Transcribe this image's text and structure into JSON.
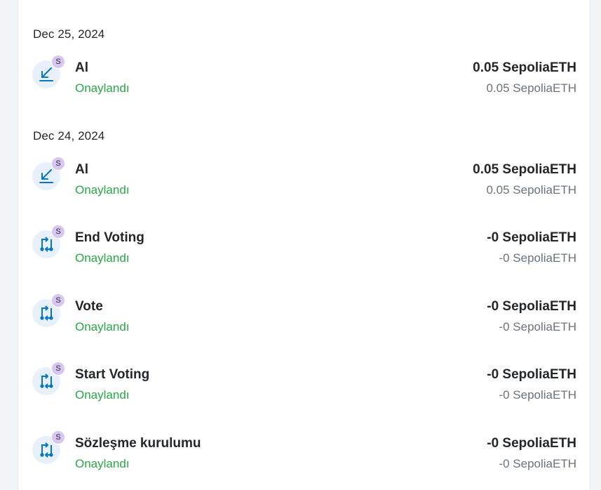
{
  "colors": {
    "status_confirmed": "#28a745",
    "icon_accent": "#0376c9",
    "icon_bg": "#e8f1fb",
    "badge_bg": "#d7c6f1"
  },
  "groups": [
    {
      "date": "Dec 25, 2024",
      "transactions": [
        {
          "icon": "receive-icon",
          "badge": "S",
          "title": "Al",
          "status": "Onaylandı",
          "amount": "0.05 SepoliaETH",
          "secondary_amount": "0.05 SepoliaETH"
        }
      ]
    },
    {
      "date": "Dec 24, 2024",
      "transactions": [
        {
          "icon": "receive-icon",
          "badge": "S",
          "title": "Al",
          "status": "Onaylandı",
          "amount": "0.05 SepoliaETH",
          "secondary_amount": "0.05 SepoliaETH"
        },
        {
          "icon": "contract-interaction-icon",
          "badge": "S",
          "title": "End Voting",
          "status": "Onaylandı",
          "amount": "-0 SepoliaETH",
          "secondary_amount": "-0 SepoliaETH"
        },
        {
          "icon": "contract-interaction-icon",
          "badge": "S",
          "title": "Vote",
          "status": "Onaylandı",
          "amount": "-0 SepoliaETH",
          "secondary_amount": "-0 SepoliaETH"
        },
        {
          "icon": "contract-interaction-icon",
          "badge": "S",
          "title": "Start Voting",
          "status": "Onaylandı",
          "amount": "-0 SepoliaETH",
          "secondary_amount": "-0 SepoliaETH"
        },
        {
          "icon": "contract-interaction-icon",
          "badge": "S",
          "title": "Sözleşme kurulumu",
          "status": "Onaylandı",
          "amount": "-0 SepoliaETH",
          "secondary_amount": "-0 SepoliaETH"
        }
      ]
    }
  ]
}
